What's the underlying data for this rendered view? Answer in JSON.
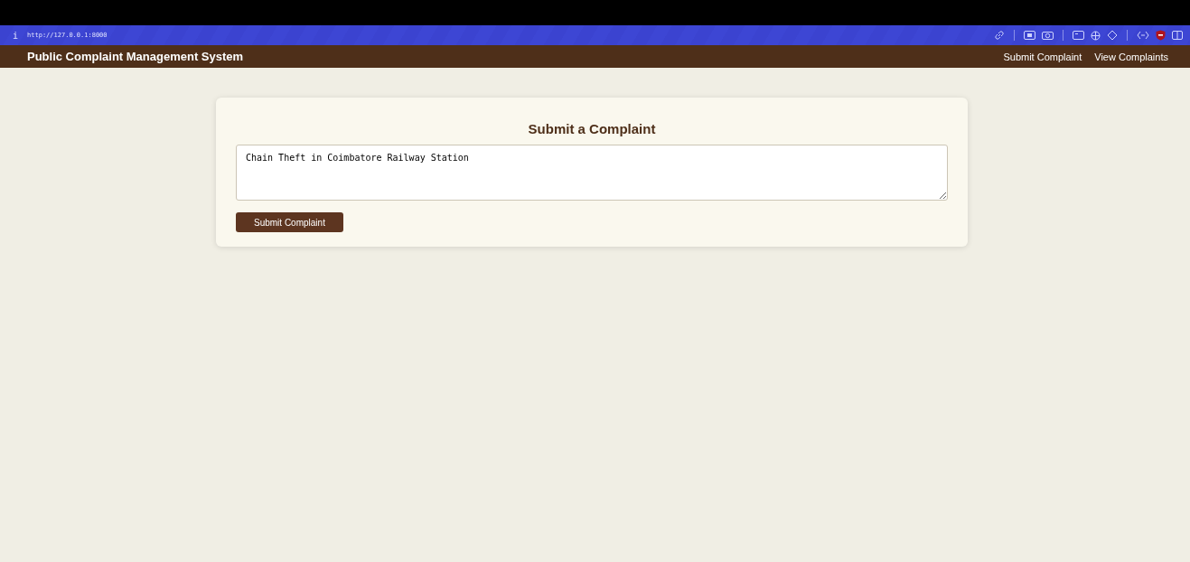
{
  "browser": {
    "info": "i",
    "url": "http://127.0.0.1:8000"
  },
  "navbar": {
    "title": "Public Complaint Management System",
    "links": [
      {
        "label": "Submit Complaint"
      },
      {
        "label": "View Complaints"
      }
    ]
  },
  "form": {
    "heading": "Submit a Complaint",
    "complaint_text": "Chain Theft in Coimbatore Railway Station",
    "submit_button": "Submit Complaint"
  }
}
